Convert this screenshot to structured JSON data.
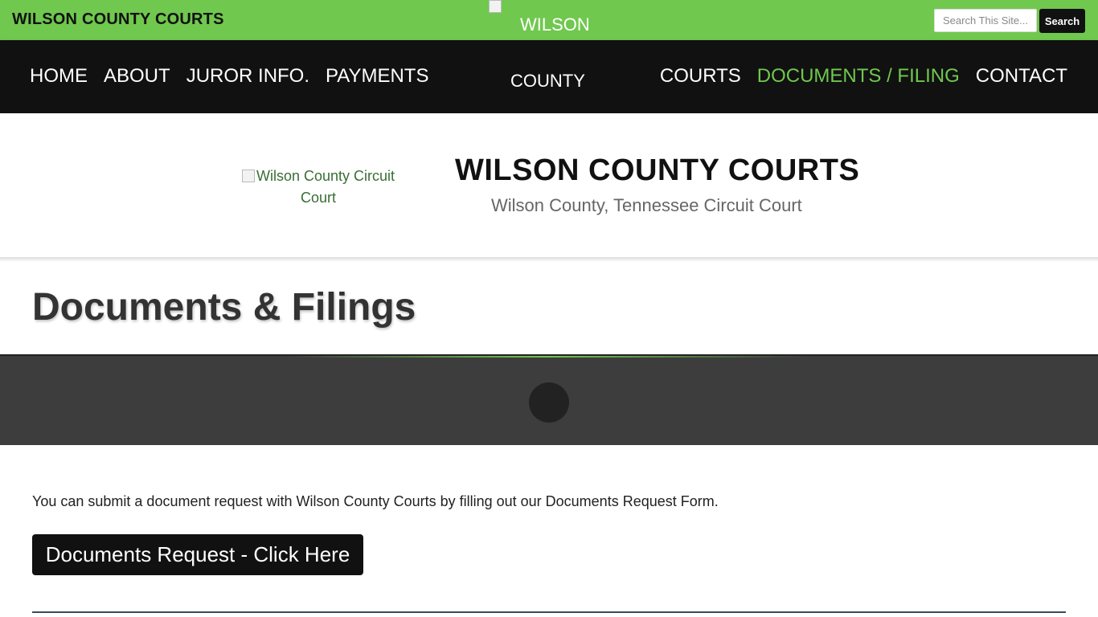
{
  "topbar": {
    "site_name": "WILSON COUNTY COURTS",
    "search_placeholder": "Search This Site...",
    "search_button": "Search"
  },
  "nav": {
    "left": [
      "HOME",
      "ABOUT",
      "JUROR INFO.",
      "PAYMENTS"
    ],
    "right": [
      "COURTS",
      "DOCUMENTS / FILING",
      "CONTACT"
    ],
    "active": "DOCUMENTS / FILING"
  },
  "center_logo_alt": {
    "line1": "WILSON",
    "line2": "COUNTY"
  },
  "hero": {
    "logo_alt": "Wilson County Circuit Court",
    "title": "WILSON COUNTY COURTS",
    "subtitle": "Wilson County, Tennessee Circuit Court"
  },
  "page": {
    "title": "Documents & Filings",
    "body_text": "You can submit a document request with Wilson County Courts by filling out our Documents Request Form.",
    "cta_label": "Documents Request - Click Here"
  },
  "colors": {
    "accent": "#70c84e",
    "nav_bg": "#111111",
    "band_bg": "#3d3d3d"
  }
}
